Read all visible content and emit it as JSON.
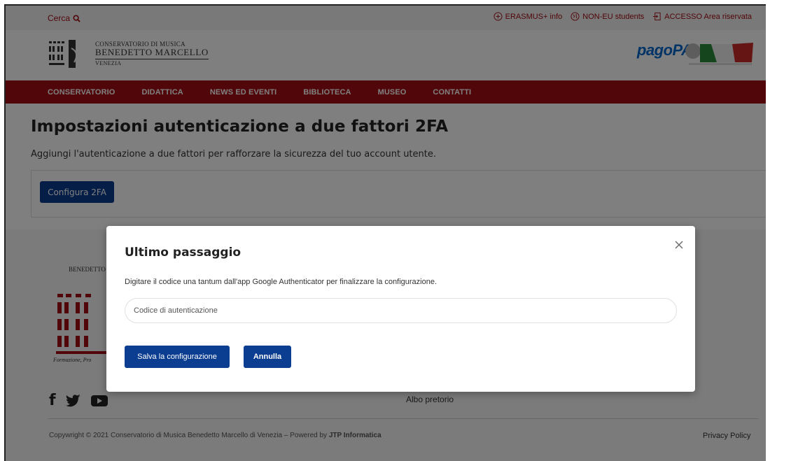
{
  "topbar": {
    "search_label": "Cerca",
    "links": [
      {
        "label": "ERASMUS+ info",
        "icon": "plus-circle-icon"
      },
      {
        "label": "NON-EU students",
        "icon": "globe-icon"
      },
      {
        "label": "ACCESSO Area riservata",
        "icon": "login-icon"
      }
    ]
  },
  "logo": {
    "line1": "CONSERVATORIO DI MUSICA",
    "line2": "BENEDETTO MARCELLO",
    "line3": "VENEZIA"
  },
  "header": {
    "pagopa": "pagoPA"
  },
  "nav": {
    "items": [
      "CONSERVATORIO",
      "DIDATTICA",
      "NEWS ED EVENTI",
      "BIBLIOTECA",
      "MUSEO",
      "CONTATTI"
    ]
  },
  "main": {
    "title": "Impostazioni autenticazione a due fattori 2FA",
    "subtitle": "Aggiungi l'autenticazione a due fattori per rafforzare la sicurezza del tuo account utente.",
    "configure_button": "Configura 2FA"
  },
  "footer": {
    "name": "BENEDETTO",
    "motto": "Formazione, Pro",
    "albo": "Albo pretorio",
    "copyright_prefix": "Copywright © 2021 Conservatorio di Musica Benedetto Marcello di Venezia – Powered by ",
    "copyright_brand": "JTP Informatica",
    "privacy": "Privacy Policy"
  },
  "modal": {
    "title": "Ultimo passaggio",
    "text": "Digitare il codice una tantum dall'app Google Authenticator per finalizzare la configurazione.",
    "input_placeholder": "Codice di autenticazione",
    "input_value": "",
    "save_button": "Salva la configurazione",
    "cancel_button": "Annulla"
  },
  "colors": {
    "brand_red": "#a30c14",
    "primary_blue": "#0b3d91"
  }
}
